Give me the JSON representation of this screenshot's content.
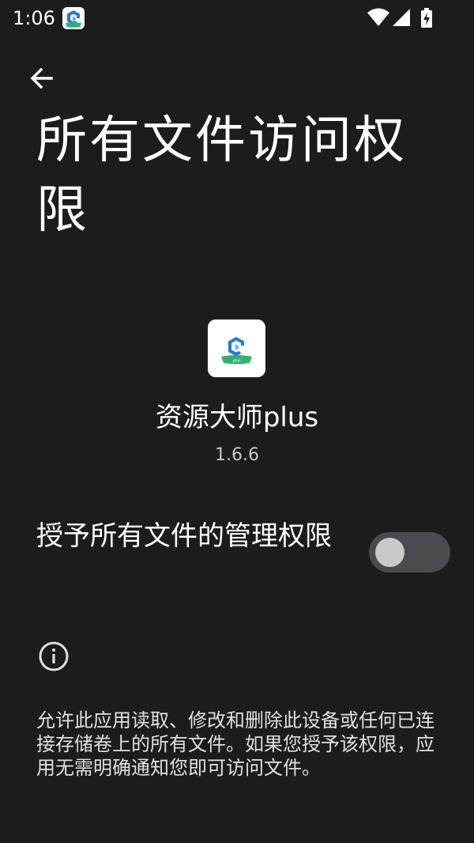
{
  "status_bar": {
    "time": "1:06",
    "icons": [
      "app-notification-icon",
      "wifi-icon",
      "cellular-signal-icon",
      "battery-charging-icon"
    ]
  },
  "header": {
    "back_icon": "arrow-left-icon",
    "title": "所有文件访问权限"
  },
  "app": {
    "name": "资源大师plus",
    "version": "1.6.6",
    "icon_badge_text": "plus"
  },
  "permission": {
    "label": "授予所有文件的管理权限",
    "enabled": false
  },
  "info": {
    "icon": "info-icon",
    "description": "允许此应用读取、修改和删除此设备或任何已连接存储卷上的所有文件。如果您授予该权限，应用无需明确通知您即可访问文件。"
  },
  "colors": {
    "background": "#1c1c1c",
    "text_primary": "#ffffff",
    "text_secondary": "#c8c8c8",
    "switch_track_off": "#4a4b4e",
    "switch_thumb_off": "#c9c9c9",
    "icon_blue": "#1f7bd8",
    "icon_green": "#2db36b"
  }
}
